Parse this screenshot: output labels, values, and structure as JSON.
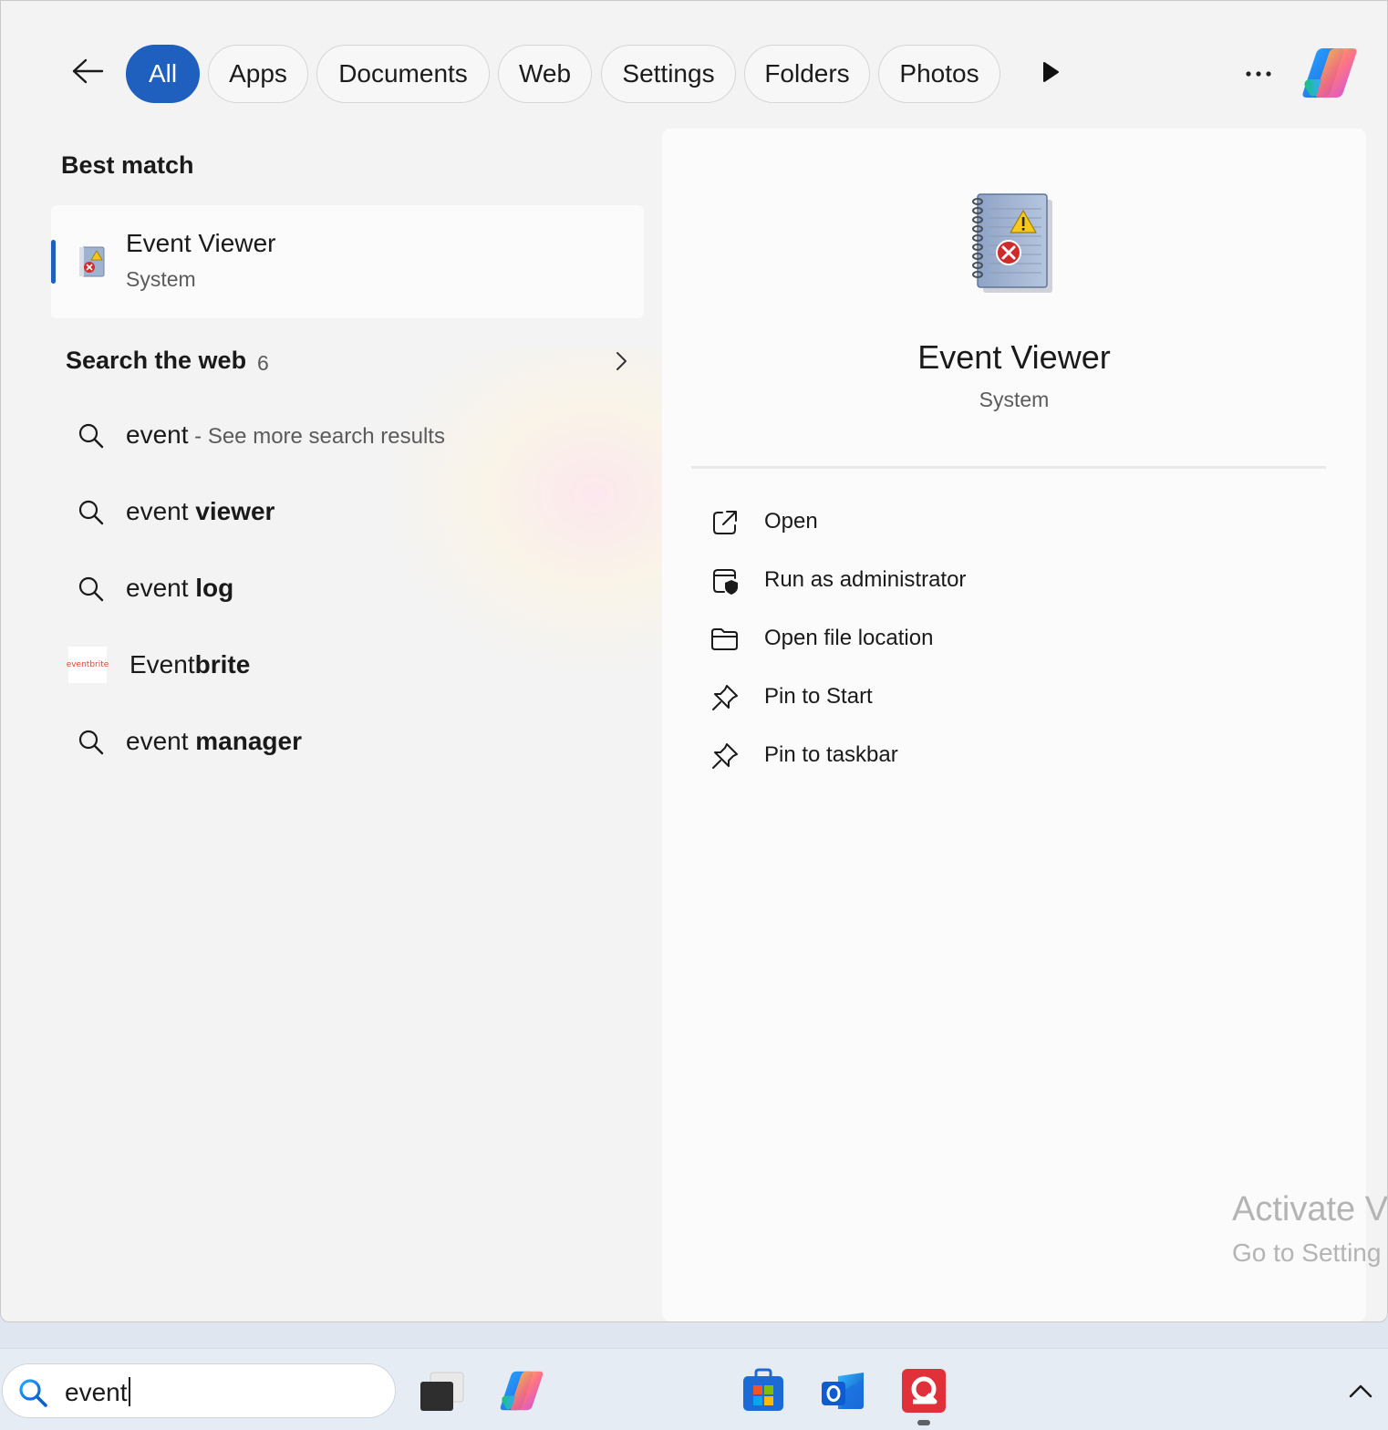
{
  "filters": {
    "back_icon": "arrow-left-icon",
    "tabs": [
      {
        "label": "All",
        "active": true
      },
      {
        "label": "Apps",
        "active": false
      },
      {
        "label": "Documents",
        "active": false
      },
      {
        "label": "Web",
        "active": false
      },
      {
        "label": "Settings",
        "active": false
      },
      {
        "label": "Folders",
        "active": false
      },
      {
        "label": "Photos",
        "active": false
      }
    ],
    "more_tabs_icon": "play-triangle-icon",
    "overflow_icon": "ellipsis-icon",
    "copilot_icon": "copilot-icon"
  },
  "best_match": {
    "heading": "Best match",
    "name": "Event Viewer",
    "category": "System",
    "icon": "event-viewer-icon"
  },
  "search_web": {
    "heading": "Search the web",
    "count": "6",
    "chevron_icon": "chevron-right-icon",
    "suggestions": [
      {
        "prefix": "event",
        "bold": "",
        "suffix": " - See more search results",
        "icon": "search-icon"
      },
      {
        "prefix": "event ",
        "bold": "viewer",
        "suffix": "",
        "icon": "search-icon"
      },
      {
        "prefix": "event ",
        "bold": "log",
        "suffix": "",
        "icon": "search-icon"
      },
      {
        "prefix": "Event",
        "bold": "brite",
        "suffix": "",
        "icon": "eventbrite-logo",
        "logo_text": "eventbrite"
      },
      {
        "prefix": "event ",
        "bold": "manager",
        "suffix": "",
        "icon": "search-icon"
      }
    ]
  },
  "detail": {
    "name": "Event Viewer",
    "category": "System",
    "actions": [
      {
        "label": "Open",
        "icon": "open-external-icon"
      },
      {
        "label": "Run as administrator",
        "icon": "shield-window-icon"
      },
      {
        "label": "Open file location",
        "icon": "folder-icon"
      },
      {
        "label": "Pin to Start",
        "icon": "pin-icon"
      },
      {
        "label": "Pin to taskbar",
        "icon": "pin-icon"
      }
    ]
  },
  "watermark": {
    "line1": "Activate V",
    "line2": "Go to Setting"
  },
  "taskbar": {
    "search_value": "event",
    "apps": [
      "task-view-icon",
      "copilot-icon",
      "microsoft-store-icon",
      "outlook-icon",
      "quip-app-icon"
    ],
    "tray_chevron": "chevron-up-icon"
  },
  "colors": {
    "accent": "#1f5fbd",
    "eventbrite": "#e1461e",
    "quip_red": "#e0313b"
  }
}
